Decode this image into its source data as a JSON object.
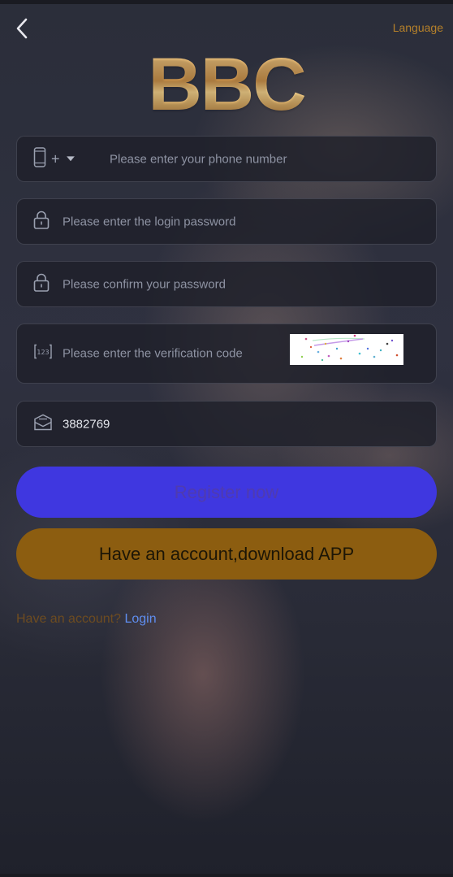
{
  "header": {
    "back_icon": "chevron-left-icon",
    "language_label": "Language",
    "logo_text": "BBC"
  },
  "form": {
    "phone": {
      "icon": "phone-icon",
      "prefix": "+",
      "dropdown_icon": "caret-down-icon",
      "placeholder": "Please enter your phone number"
    },
    "password": {
      "icon": "lock-icon",
      "placeholder": "Please enter the login password"
    },
    "confirm_password": {
      "icon": "lock-icon",
      "placeholder": "Please confirm your password"
    },
    "verification": {
      "icon": "number-code-icon",
      "icon_text": "123",
      "placeholder": "Please enter the verification code"
    },
    "invite": {
      "icon": "envelope-icon",
      "value": "3882769"
    }
  },
  "buttons": {
    "register_label": "Register now",
    "download_label": "Have an account,download APP"
  },
  "footer": {
    "question": "Have an account?",
    "login_link": "Login"
  },
  "colors": {
    "accent_gold": "#b5802a",
    "register_button": "#3f37e0",
    "download_button": "#8c5d10",
    "login_link": "#5f8ef0"
  }
}
